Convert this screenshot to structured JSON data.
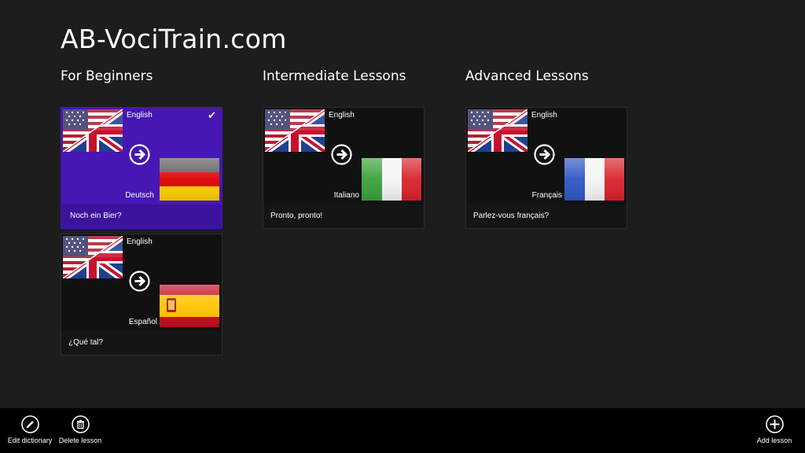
{
  "app": {
    "title": "AB-VociTrain.com"
  },
  "groups": [
    {
      "header": "For Beginners"
    },
    {
      "header": "Intermediate Lessons"
    },
    {
      "header": "Advanced Lessons"
    }
  ],
  "lessons": [
    {
      "source_lang": "English",
      "target_lang": "Deutsch",
      "caption": "Noch ein Bier?",
      "selected": true,
      "source_flag": "us-uk-flag",
      "target_flag": "germany-flag",
      "check": "✔"
    },
    {
      "source_lang": "English",
      "target_lang": "Español",
      "caption": "¿Qué tal?",
      "selected": false,
      "source_flag": "us-uk-flag",
      "target_flag": "spain-flag"
    },
    {
      "source_lang": "English",
      "target_lang": "Italiano",
      "caption": "Pronto, pronto!",
      "selected": false,
      "source_flag": "us-uk-flag",
      "target_flag": "italy-flag"
    },
    {
      "source_lang": "English",
      "target_lang": "Français",
      "caption": "Parlez-vous français?",
      "selected": false,
      "source_flag": "us-uk-flag",
      "target_flag": "france-flag"
    }
  ],
  "appbar": {
    "edit_dictionary": "Edit dictionary",
    "delete_lesson": "Delete lesson",
    "add_lesson": "Add lesson"
  },
  "colors": {
    "background": "#1d1d1d",
    "selected_tile": "#4617b4",
    "appbar": "#000000"
  }
}
